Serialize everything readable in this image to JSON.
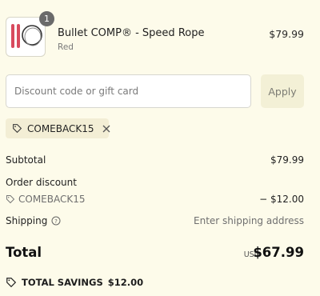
{
  "cart": {
    "item": {
      "quantity": "1",
      "name": "Bullet COMP® - Speed Rope",
      "variant": "Red",
      "price": "$79.99"
    }
  },
  "discount": {
    "placeholder": "Discount code or gift card",
    "apply_label": "Apply",
    "applied_code": "COMEBACK15"
  },
  "summary": {
    "subtotal_label": "Subtotal",
    "subtotal_value": "$79.99",
    "order_discount_label": "Order discount",
    "discount_code": "COMEBACK15",
    "discount_value": "− $12.00",
    "shipping_label": "Shipping",
    "shipping_value": "Enter shipping address",
    "total_label": "Total",
    "currency": "USD",
    "total_value": "$67.99",
    "savings_label": "TOTAL SAVINGS",
    "savings_value": "$12.00"
  },
  "colors": {
    "background": "#fdfbea",
    "accent_chip": "#f3eed5",
    "product_handle": "#d84a5d"
  },
  "icons": [
    "tag-icon",
    "close-icon",
    "info-icon"
  ]
}
